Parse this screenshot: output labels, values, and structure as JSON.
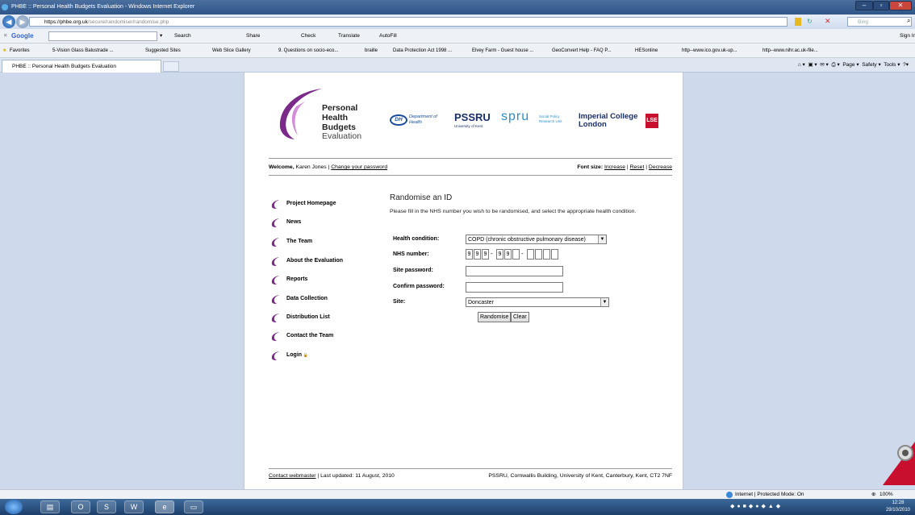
{
  "window": {
    "title": "PHBE :: Personal Health Budgets Evaluation - Windows Internet Explorer"
  },
  "address": {
    "url_host": "https://phbe.org.uk",
    "url_path": "/secure/randomiser/randomise.php",
    "search_placeholder": "Bing"
  },
  "toolbar": {
    "google_label": "Google",
    "search": "Search",
    "share": "Share",
    "check": "Check",
    "translate": "Translate",
    "autofill": "AutoFill",
    "sign_in": "Sign In"
  },
  "favorites": {
    "label": "Favorites",
    "items": [
      "5-Vision Glass Balustrade ...",
      "Suggested Sites",
      "Web Slice Gallery",
      "9. Questions on socio-eco...",
      "braille",
      "Data Protection Act 1998 ...",
      "Elvey Farm - Guest house ...",
      "GeoConvert Help - FAQ P...",
      "HESonline",
      "http--www.ico.gov.uk-up...",
      "http--www.nihr.ac.uk-file..."
    ]
  },
  "tab": {
    "title": "PHBE :: Personal Health Budgets Evaluation"
  },
  "commands": {
    "page": "Page",
    "safety": "Safety",
    "tools": "Tools"
  },
  "logo": {
    "line1": "Personal",
    "line2": "Health",
    "line3": "Budgets",
    "line4": "Evaluation",
    "dh": "Department of Health",
    "pssru": "PSSRU",
    "pssru_sub": "University of Kent",
    "spru": "spru",
    "spru_sub": "Social Policy Research Unit",
    "imperial": "Imperial College London",
    "lse": "LSE"
  },
  "welcome": {
    "prefix": "Welcome,",
    "name": "Karen Jones",
    "change_password": "Change your password",
    "font_size_label": "Font size:",
    "increase": "Increase",
    "reset": "Reset",
    "decrease": "Decrease"
  },
  "nav": [
    "Project Homepage",
    "News",
    "The Team",
    "About the Evaluation",
    "Reports",
    "Data Collection",
    "Distribution List",
    "Contact the Team",
    "Login"
  ],
  "form": {
    "title": "Randomise an ID",
    "description": "Please fill in the NHS number you wish to be randomised, and select the appropriate health condition.",
    "health_condition_label": "Health condition:",
    "health_condition_value": "COPD (chronic obstructive pulmonary disease)",
    "nhs_label": "NHS number:",
    "nhs_digits": [
      "9",
      "9",
      "9",
      "9",
      "9",
      "",
      "",
      "",
      "",
      ""
    ],
    "site_password_label": "Site password:",
    "confirm_password_label": "Confirm password:",
    "site_label": "Site:",
    "site_value": "Doncaster",
    "randomise_button": "Randomise",
    "clear_button": "Clear"
  },
  "footer": {
    "contact": "Contact webmaster",
    "updated": "| Last updated: 11 August, 2010",
    "address": "PSSRU, Cornwallis Building, University of Kent, Canterbury, Kent, CT2 7NF"
  },
  "status": {
    "zone": "Internet | Protected Mode: On",
    "zoom": "100%"
  },
  "clock": {
    "time": "12:28",
    "date": "29/10/2010"
  },
  "colors": {
    "brand_purple": "#7b2a8a",
    "accent_blue": "#1a4d9c",
    "lse_red": "#c8102e"
  }
}
